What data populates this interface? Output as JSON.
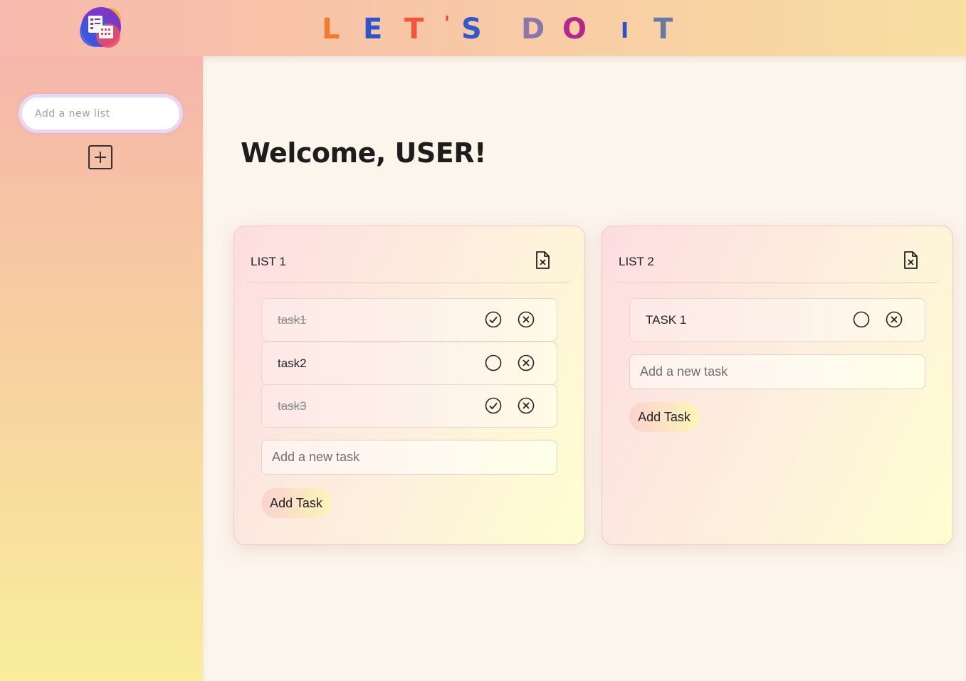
{
  "brand": {
    "letters": [
      "L",
      "E",
      "T",
      "'",
      "S",
      "D",
      "O",
      "I",
      "T"
    ],
    "colors": [
      "#f47a2e",
      "#2f56c9",
      "#f2553b",
      "#e8453b",
      "#3558c9",
      "#8a77a8",
      "#b3288a",
      "#2a52d0",
      "#6a78a6"
    ]
  },
  "sidebar": {
    "new_list_placeholder": "Add a new list"
  },
  "main": {
    "welcome": "Welcome, USER!"
  },
  "lists": [
    {
      "title": "LIST 1",
      "tasks": [
        {
          "text": "task1",
          "done": true
        },
        {
          "text": "task2",
          "done": false
        },
        {
          "text": "task3",
          "done": true
        }
      ],
      "new_task_placeholder": "Add a new task",
      "add_label": "Add Task"
    },
    {
      "title": "LIST 2",
      "tasks": [
        {
          "text": "TASK 1",
          "done": false
        }
      ],
      "new_task_placeholder": "Add a new task",
      "add_label": "Add Task"
    }
  ]
}
